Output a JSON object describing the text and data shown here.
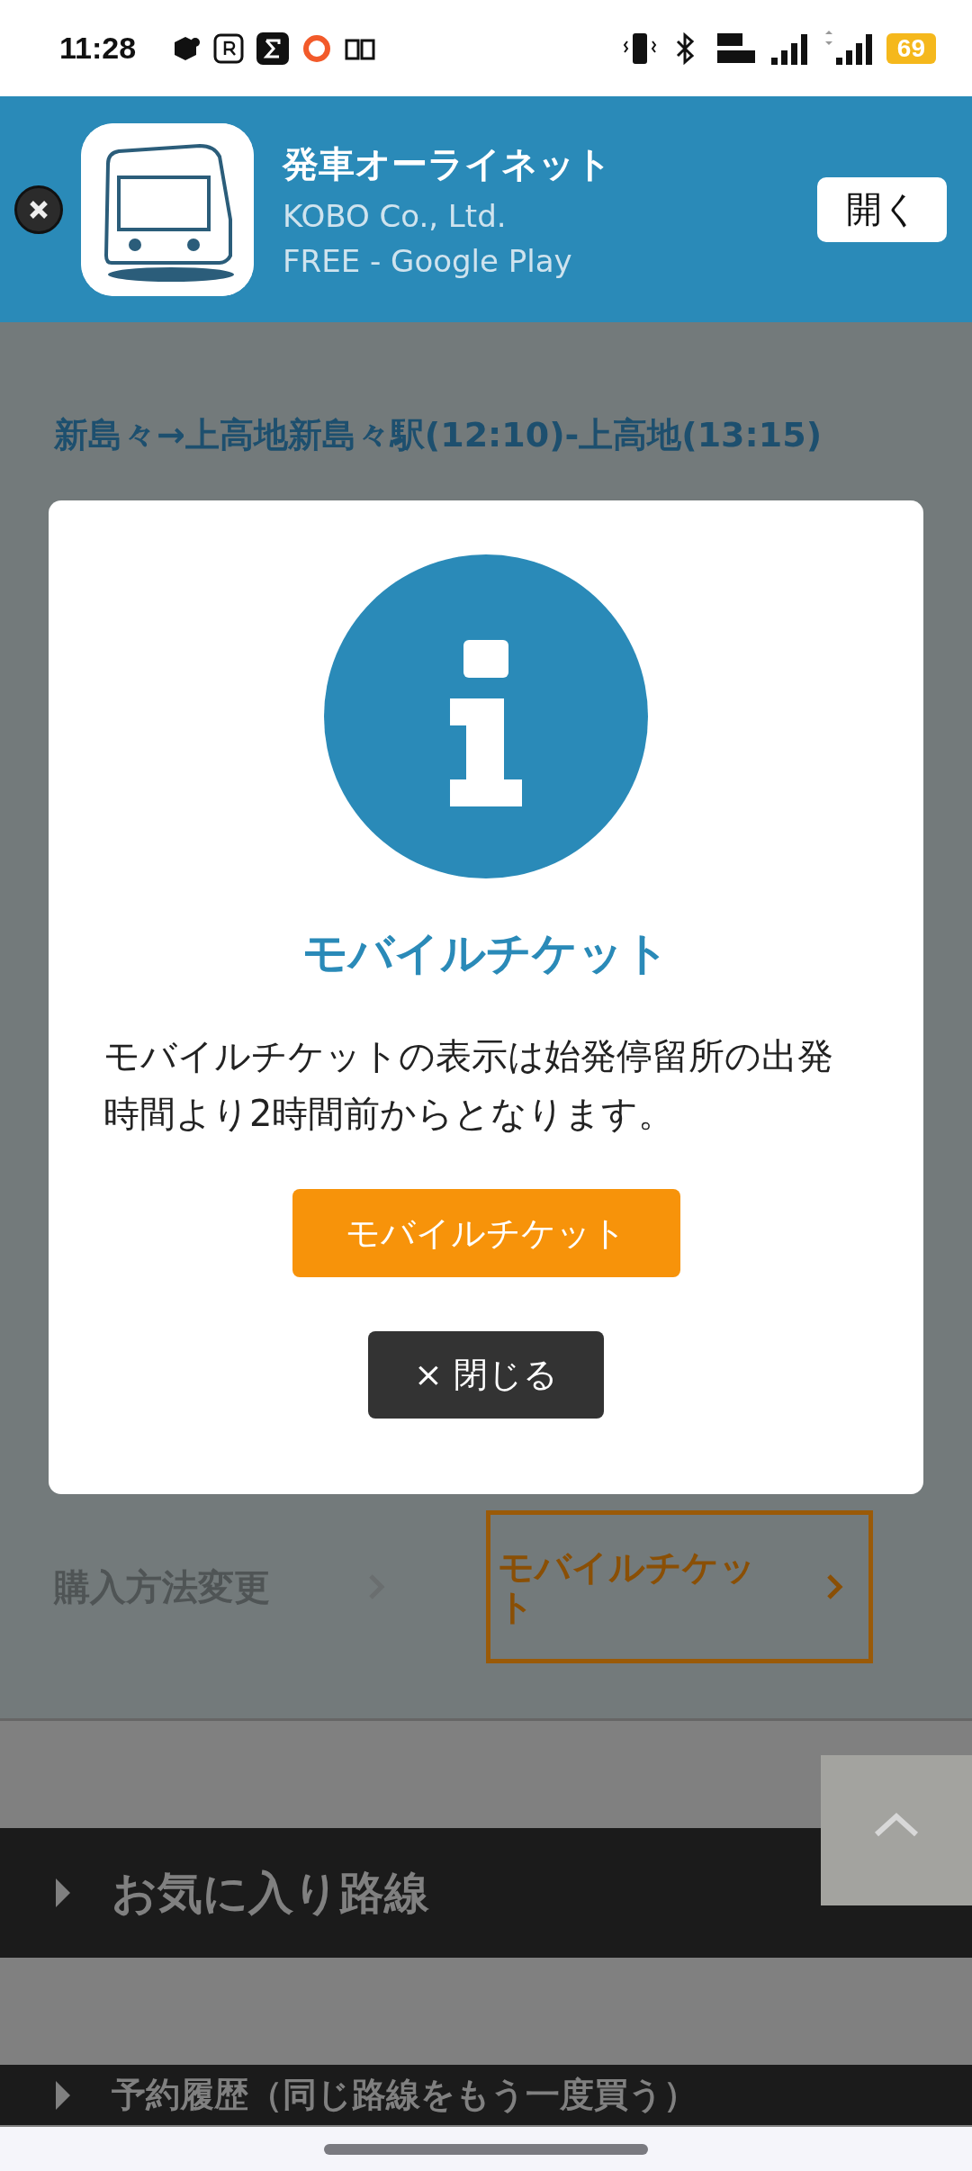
{
  "status_bar": {
    "time": "11:28",
    "battery": "69"
  },
  "app_banner": {
    "title": "発車オーライネット",
    "publisher": "KOBO Co., Ltd.",
    "price": "FREE - Google Play",
    "open_button": "開く"
  },
  "route_title": "新島々→上高地新島々駅(12:10)-上高地(13:15)",
  "actions": [
    {
      "label": "購入方法変更",
      "kind": "plain"
    },
    {
      "label": "モバイルチケット",
      "kind": "outlined"
    }
  ],
  "menu": [
    "お気に入り路線",
    "予約履歴（同じ路線をもう一度買う）"
  ],
  "modal": {
    "title": "モバイルチケット",
    "message": "モバイルチケットの表示は始発停留所の出発時間より2時間前からとなります。",
    "primary_button": "モバイルチケット",
    "close_button": "× 閉じる"
  }
}
